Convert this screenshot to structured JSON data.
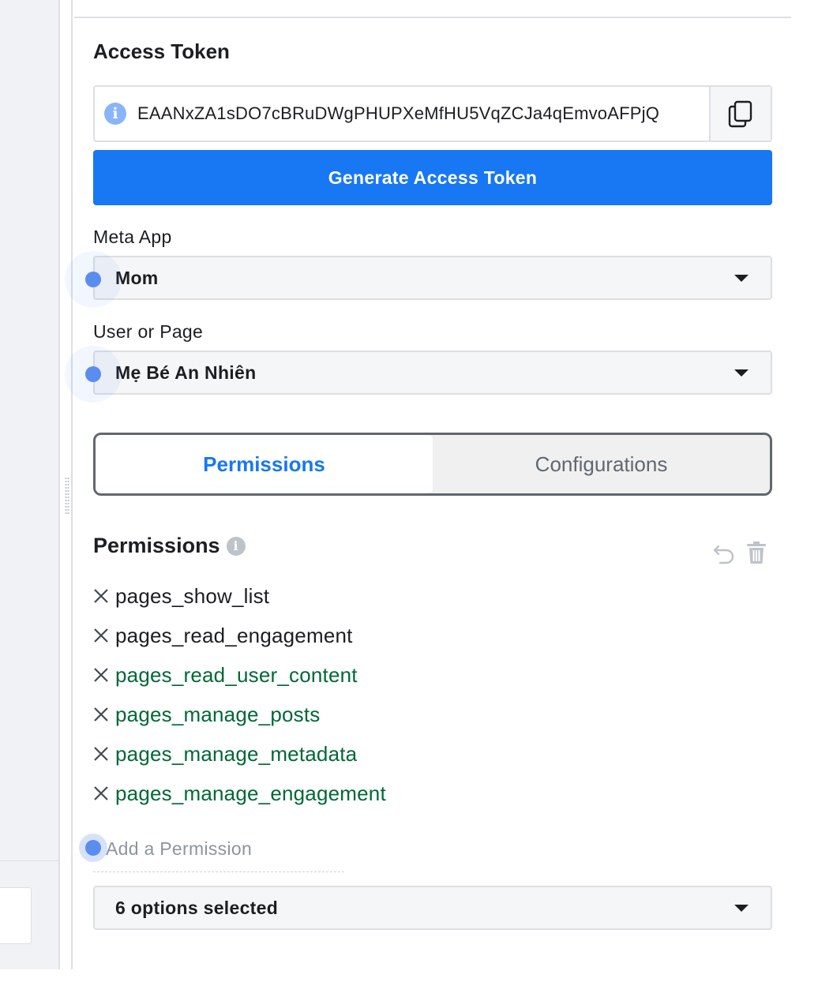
{
  "access_token": {
    "title": "Access Token",
    "value": "EAANxZA1sDO7cBRuDWgPHUPXeMfHU5VqZCJa4qEmvoAFPjQ",
    "copy_icon": "copy-icon",
    "info_icon": "info-icon"
  },
  "generate_button": {
    "label": "Generate Access Token",
    "color": "#1877f2"
  },
  "meta_app": {
    "label": "Meta App",
    "selected": "Mom"
  },
  "user_or_page": {
    "label": "User or Page",
    "selected": "Mẹ Bé An Nhiên"
  },
  "tabs": [
    {
      "label": "Permissions",
      "active": true
    },
    {
      "label": "Configurations",
      "active": false
    }
  ],
  "permissions": {
    "title": "Permissions",
    "items": [
      {
        "name": "pages_show_list",
        "color": "#1c1e21"
      },
      {
        "name": "pages_read_engagement",
        "color": "#1c1e21"
      },
      {
        "name": "pages_read_user_content",
        "color": "#006837"
      },
      {
        "name": "pages_manage_posts",
        "color": "#006837"
      },
      {
        "name": "pages_manage_metadata",
        "color": "#006837"
      },
      {
        "name": "pages_manage_engagement",
        "color": "#006837"
      }
    ],
    "add_placeholder": "Add a Permission",
    "summary": "6 options selected"
  }
}
